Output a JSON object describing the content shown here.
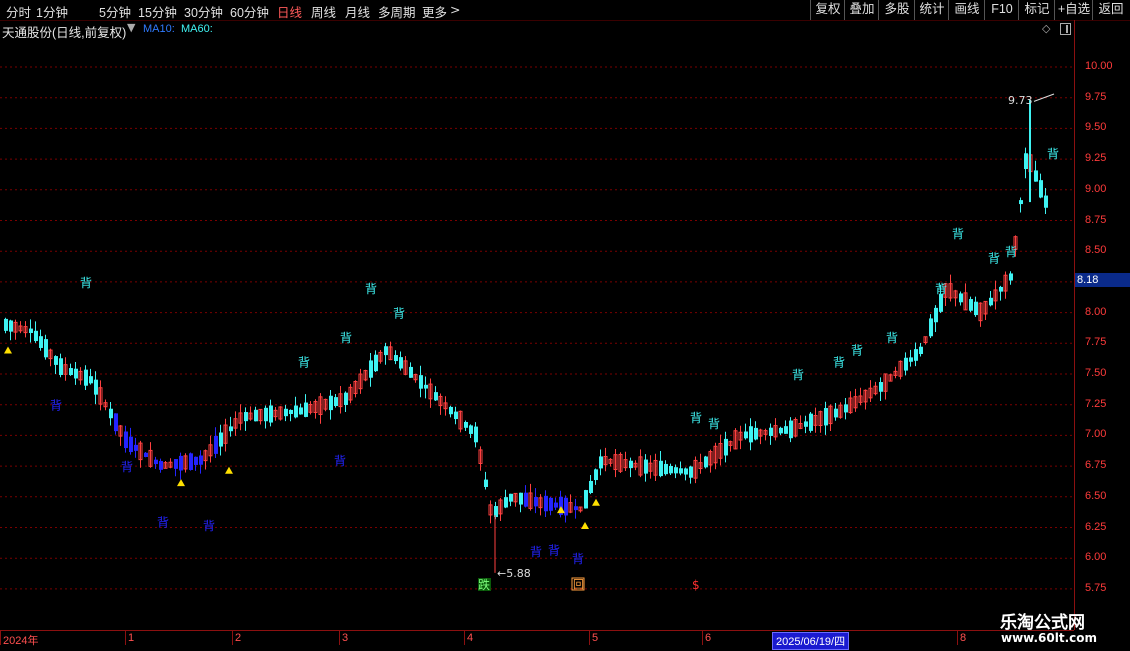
{
  "toolbar": {
    "periods": [
      "分时",
      "1分钟",
      "5分钟",
      "15分钟",
      "30分钟",
      "60分钟",
      "日线",
      "周线",
      "月线",
      "多周期",
      "更多"
    ],
    "active_period": "日线",
    "buttons": [
      "复权",
      "叠加",
      "多股",
      "统计",
      "画线",
      "F10",
      "标记",
      "+自选",
      "返回"
    ]
  },
  "stock": {
    "title": "天通股份(日线,前复权)",
    "ma1": "MA10:",
    "ma2": "MA60:"
  },
  "price_axis": {
    "ticks": [
      "10.00",
      "9.75",
      "9.50",
      "9.25",
      "9.00",
      "8.75",
      "8.50",
      "8.25",
      "8.00",
      "7.75",
      "7.50",
      "7.25",
      "7.00",
      "6.75",
      "6.50",
      "6.25",
      "6.00",
      "5.75"
    ],
    "current_price": "8.18"
  },
  "annotations": {
    "high": "9.73",
    "low": "5.88",
    "signal_char": "背",
    "event_markers": [
      "跌",
      "回",
      "$"
    ]
  },
  "date_axis": {
    "labels": [
      "2024年",
      "1",
      "2",
      "3",
      "4",
      "5",
      "6",
      "8"
    ],
    "crosshair_date": "2025/06/19/四"
  },
  "watermark": {
    "name": "乐淘公式网",
    "url": "www.60lt.com"
  },
  "colors": {
    "up": "#ff4040",
    "down_cyan": "#3ff3f3",
    "down_blue": "#2424ff",
    "grid": "#7a0000",
    "axis_text": "#ff3b3b",
    "highlight_bg": "#0a2a8a"
  }
}
